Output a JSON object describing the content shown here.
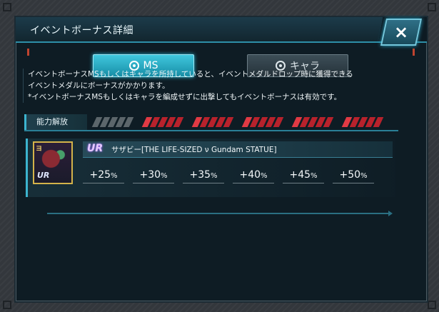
{
  "header": {
    "title": "イベントボーナス詳細",
    "close_icon": "×"
  },
  "tabs": [
    {
      "label": "MS",
      "icon": "target-icon",
      "active": true
    },
    {
      "label": "キャラ",
      "icon": "target-icon",
      "active": false
    }
  ],
  "description": {
    "line1": "イベントボーナスMSもしくはキャラを所持していると、イベントメダルドロップ時に獲得できる",
    "line2": "イベントメダルにボーナスがかかります。",
    "line3": "*イベントボーナスMSもしくはキャラを編成せずに出撃してもイベントボーナスは有効です。"
  },
  "release": {
    "label": "能力解放",
    "levels": [
      {
        "state": "off"
      },
      {
        "state": "red"
      },
      {
        "state": "red"
      },
      {
        "state": "red"
      },
      {
        "state": "red"
      },
      {
        "state": "red"
      }
    ]
  },
  "unit": {
    "rarity": "UR",
    "thumb_badge": "ヨ",
    "name": "サザビー[THE LIFE-SIZED ν Gundam STATUE]",
    "bonuses": [
      {
        "value": "+25",
        "unit": "%"
      },
      {
        "value": "+30",
        "unit": "%"
      },
      {
        "value": "+35",
        "unit": "%"
      },
      {
        "value": "+40",
        "unit": "%"
      },
      {
        "value": "+45",
        "unit": "%"
      },
      {
        "value": "+50",
        "unit": "%"
      }
    ]
  },
  "colors": {
    "accent": "#3cb4cf",
    "active_tab": "#2bb3cd",
    "gauge_red": "#b8222c",
    "panel_bg": "#0e1c24"
  }
}
